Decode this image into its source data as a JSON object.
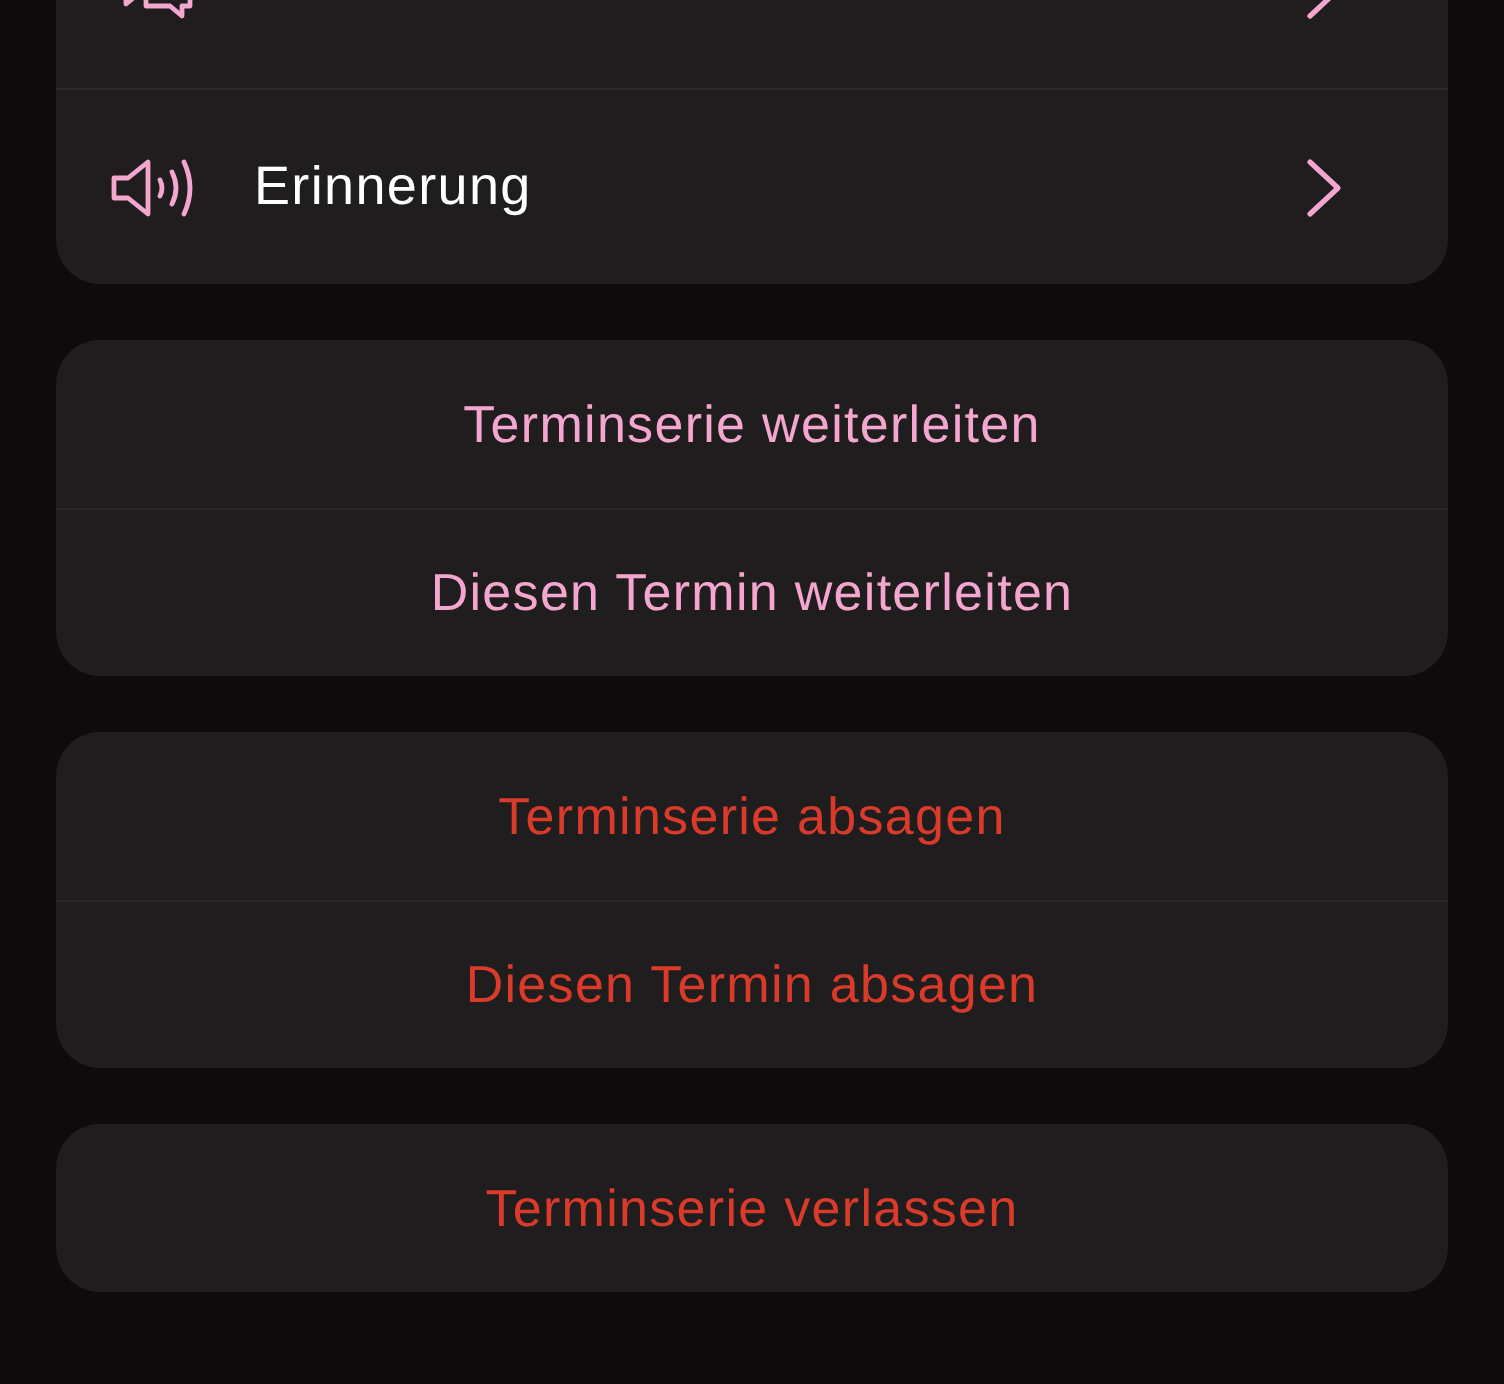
{
  "menu_items": [
    {
      "kind": "chat"
    },
    {
      "label": "Erinnerung",
      "kind": "speaker"
    }
  ],
  "action_groups": [
    {
      "actions": [
        {
          "label": "Terminserie weiterleiten",
          "kind": "default"
        },
        {
          "label": "Diesen Termin weiterleiten",
          "kind": "default"
        }
      ]
    },
    {
      "actions": [
        {
          "label": "Terminserie absagen",
          "kind": "destructive"
        },
        {
          "label": "Diesen Termin absagen",
          "kind": "destructive"
        }
      ]
    },
    {
      "actions": [
        {
          "label": "Terminserie verlassen",
          "kind": "destructive"
        }
      ]
    }
  ]
}
